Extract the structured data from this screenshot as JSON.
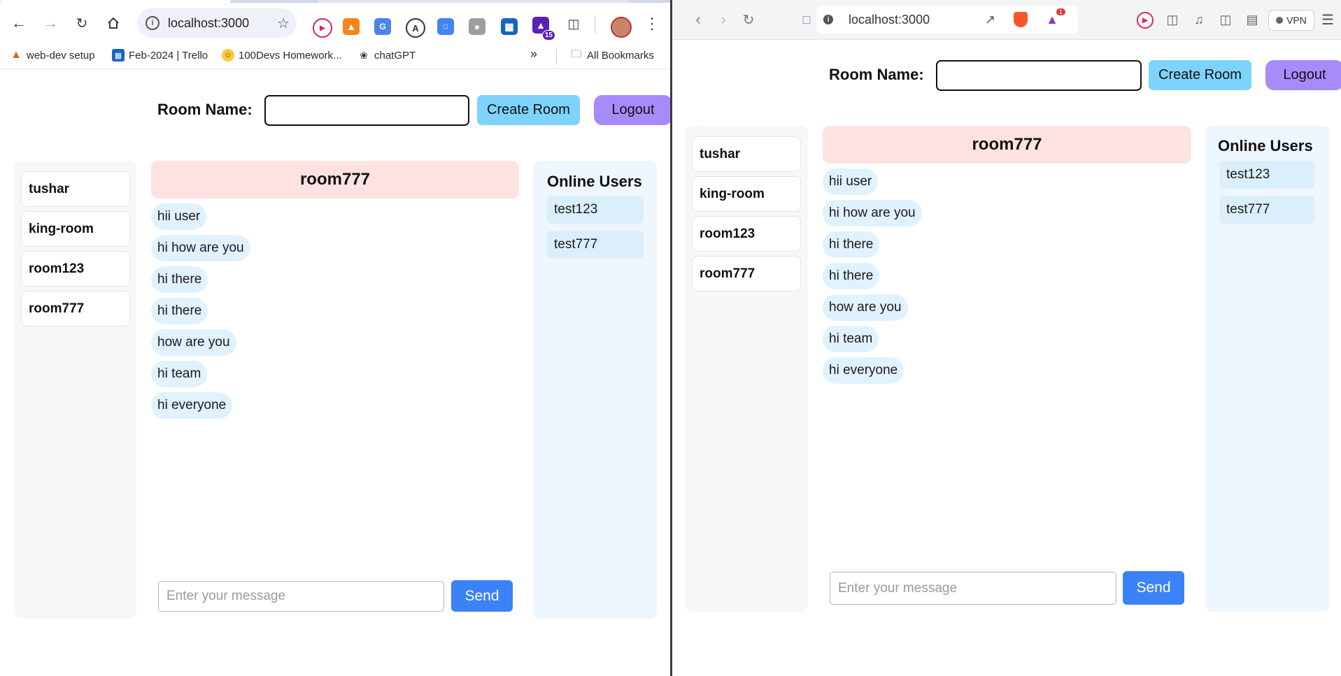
{
  "left_browser": {
    "url": "localhost:3000",
    "bookmarks": [
      "web-dev setup",
      "Feb-2024 | Trello",
      "100Devs Homework...",
      "chatGPT"
    ],
    "all_bookmarks": "All Bookmarks",
    "ext_badge": "15"
  },
  "right_browser": {
    "url": "localhost:3000",
    "vpn_label": "VPN",
    "notif_badge": "1"
  },
  "app": {
    "room_name_label": "Room Name:",
    "room_name_value": "",
    "create_room_label": "Create Room",
    "logout_label": "Logout",
    "rooms": [
      "tushar",
      "king-room",
      "room123",
      "room777"
    ],
    "active_room": "room777",
    "messages": [
      "hii user",
      "hi how are you",
      "hi there",
      "hi there",
      "how are you",
      "hi team",
      "hi everyone"
    ],
    "message_placeholder": "Enter your message",
    "send_label": "Send",
    "online_title": "Online Users",
    "online_users": [
      "test123",
      "test777"
    ]
  },
  "colors": {
    "create_room": "#7dd3fc",
    "logout": "#a78bfa",
    "header": "#fee2e2",
    "message": "#e0f2fe",
    "send": "#3b82f6",
    "online_panel": "#eef6fe"
  }
}
